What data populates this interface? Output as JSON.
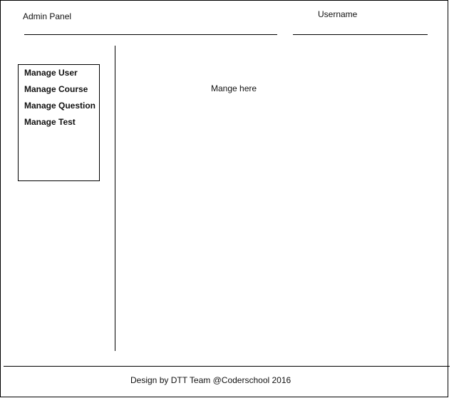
{
  "header": {
    "app_title": "Admin Panel",
    "username": "Username"
  },
  "sidebar": {
    "items": [
      {
        "label": "Manage User"
      },
      {
        "label": "Manage Course"
      },
      {
        "label": "Manage Question"
      },
      {
        "label": "Manage Test"
      }
    ]
  },
  "main": {
    "text": "Mange here"
  },
  "footer": {
    "text": "Design by DTT Team @Coderschool 2016"
  }
}
